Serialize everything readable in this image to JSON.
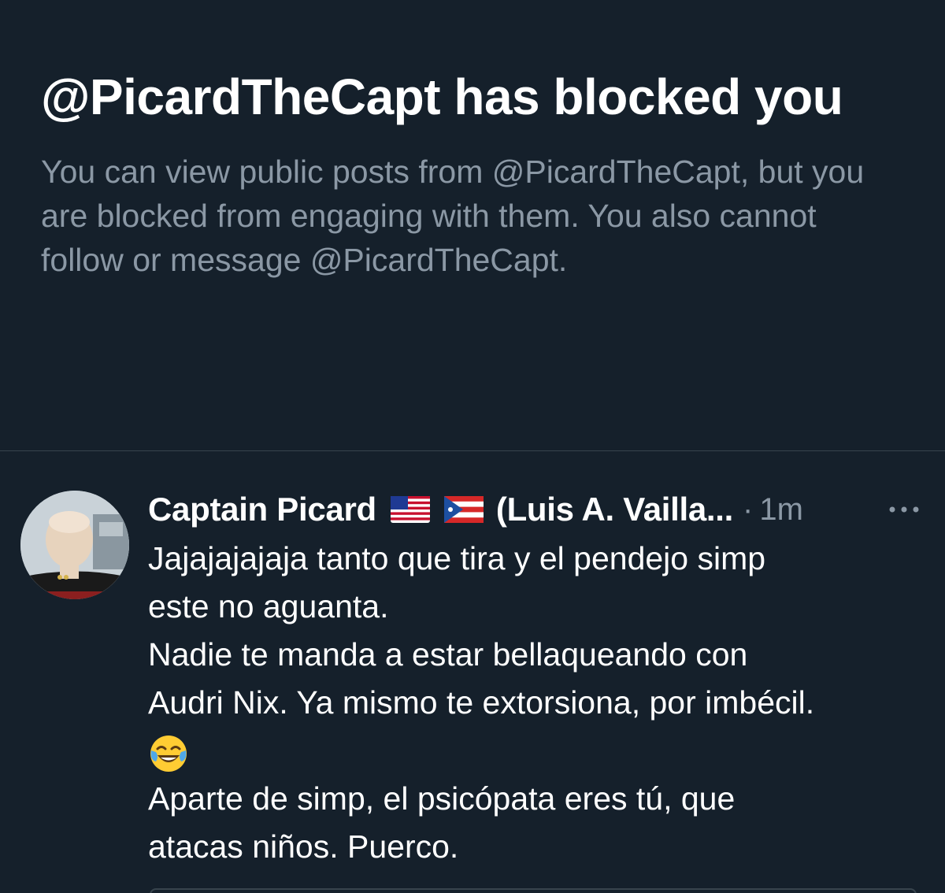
{
  "blocked_notice": {
    "title": "@PicardTheCapt has blocked you",
    "description": "You can view public posts from @PicardTheCapt, but you are blocked from engaging with them. You also cannot follow or message @PicardTheCapt."
  },
  "tweet": {
    "author_name": "Captain Picard",
    "flags": [
      "us-flag-icon",
      "puerto-rico-flag-icon"
    ],
    "author_name_extra": "(Luis A. Vailla...",
    "separator": "·",
    "timestamp": "1m",
    "more_icon": "more-horizontal-icon",
    "lines": [
      "Jajajajajaja tanto que tira y el pendejo simp",
      "este no aguanta.",
      "Nadie te manda a estar bellaqueando con",
      "Audri Nix. Ya mismo te extorsiona, por imbécil.",
      "",
      "Aparte de simp, el psicópata eres tú, que",
      "atacas niños. Puerco."
    ],
    "emoji": "face-with-tears-of-joy-icon"
  },
  "colors": {
    "background": "#15202b",
    "primary_text": "#ffffff",
    "secondary_text": "#8b98a5",
    "divider": "#38444d"
  }
}
